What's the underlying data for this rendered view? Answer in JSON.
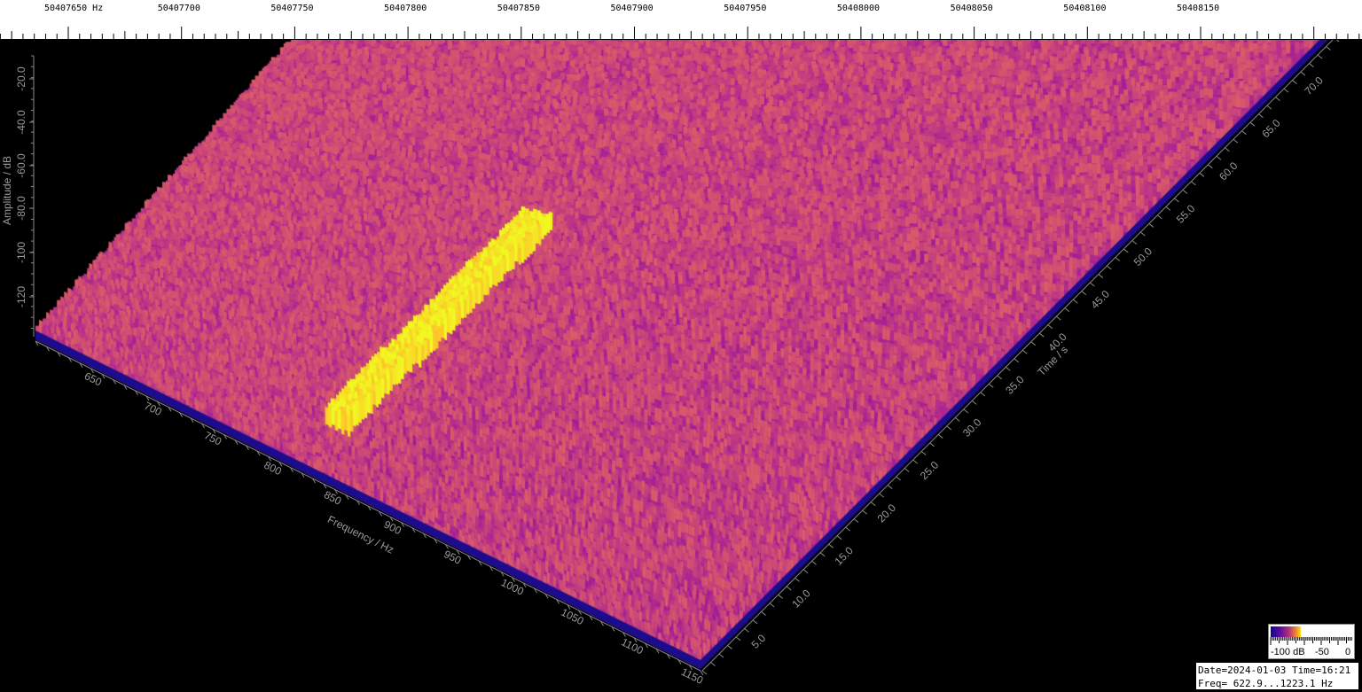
{
  "ruler": {
    "unit": "Hz",
    "labels": [
      "50407650",
      "50407700",
      "50407750",
      "50407800",
      "50407850",
      "50407900",
      "50407950",
      "50408000",
      "50408050",
      "50408100",
      "50408150"
    ]
  },
  "axes": {
    "amplitude_title": "Amplitude / dB",
    "amplitude_ticks": [
      "-20.0",
      "-40.0",
      "-60.0",
      "-80.0",
      "-100",
      "-120"
    ],
    "frequency_title": "Frequency / Hz",
    "frequency_ticks": [
      "650",
      "700",
      "750",
      "800",
      "850",
      "900",
      "950",
      "1000",
      "1050",
      "1100",
      "1150"
    ],
    "time_title": "Time / s",
    "time_ticks": [
      "5.0",
      "10.0",
      "15.0",
      "20.0",
      "25.0",
      "30.0",
      "35.0",
      "40.0",
      "45.0",
      "50.0",
      "55.0",
      "60.0",
      "65.0",
      "70.0"
    ]
  },
  "color_scale": {
    "labels": [
      "-100 dB",
      "-50",
      "0"
    ],
    "colors": [
      "#0d0887",
      "#5a0ca0",
      "#b0307b",
      "#f28b28",
      "#fce51a"
    ]
  },
  "info": {
    "line1": "Date=2024-01-03 Time=16:21",
    "line2": "Freq= 622.9...1223.1 Hz"
  }
}
